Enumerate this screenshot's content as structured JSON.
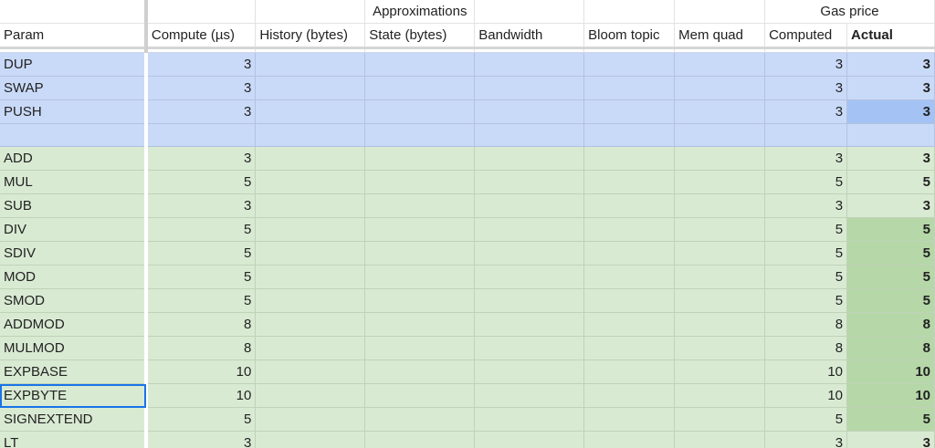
{
  "header": {
    "group_approximations": "Approximations",
    "group_gas_price": "Gas price",
    "columns": [
      "Param",
      "Compute (µs)",
      "History (bytes)",
      "State (bytes)",
      "Bandwidth",
      "Bloom topic",
      "Mem quad",
      "Computed",
      "Actual"
    ]
  },
  "rows": [
    {
      "param": "DUP",
      "compute": "3",
      "computed": "3",
      "actual": "3"
    },
    {
      "param": "SWAP",
      "compute": "3",
      "computed": "3",
      "actual": "3"
    },
    {
      "param": "PUSH",
      "compute": "3",
      "computed": "3",
      "actual": "3"
    },
    {
      "param": "",
      "compute": "",
      "computed": "",
      "actual": ""
    },
    {
      "param": "ADD",
      "compute": "3",
      "computed": "3",
      "actual": "3"
    },
    {
      "param": "MUL",
      "compute": "5",
      "computed": "5",
      "actual": "5"
    },
    {
      "param": "SUB",
      "compute": "3",
      "computed": "3",
      "actual": "3"
    },
    {
      "param": "DIV",
      "compute": "5",
      "computed": "5",
      "actual": "5"
    },
    {
      "param": "SDIV",
      "compute": "5",
      "computed": "5",
      "actual": "5"
    },
    {
      "param": "MOD",
      "compute": "5",
      "computed": "5",
      "actual": "5"
    },
    {
      "param": "SMOD",
      "compute": "5",
      "computed": "5",
      "actual": "5"
    },
    {
      "param": "ADDMOD",
      "compute": "8",
      "computed": "8",
      "actual": "8"
    },
    {
      "param": "MULMOD",
      "compute": "8",
      "computed": "8",
      "actual": "8"
    },
    {
      "param": "EXPBASE",
      "compute": "10",
      "computed": "10",
      "actual": "10"
    },
    {
      "param": "EXPBYTE",
      "compute": "10",
      "computed": "10",
      "actual": "10"
    },
    {
      "param": "SIGNEXTEND",
      "compute": "5",
      "computed": "5",
      "actual": "5"
    },
    {
      "param": "LT",
      "compute": "3",
      "computed": "3",
      "actual": "3"
    }
  ],
  "colors": {
    "blue_group": "#c9daf8",
    "green_group": "#d9ead3",
    "highlight_green": "#b6d7a8",
    "highlight_blue": "#a4c2f4",
    "selection": "#1a73e8"
  }
}
